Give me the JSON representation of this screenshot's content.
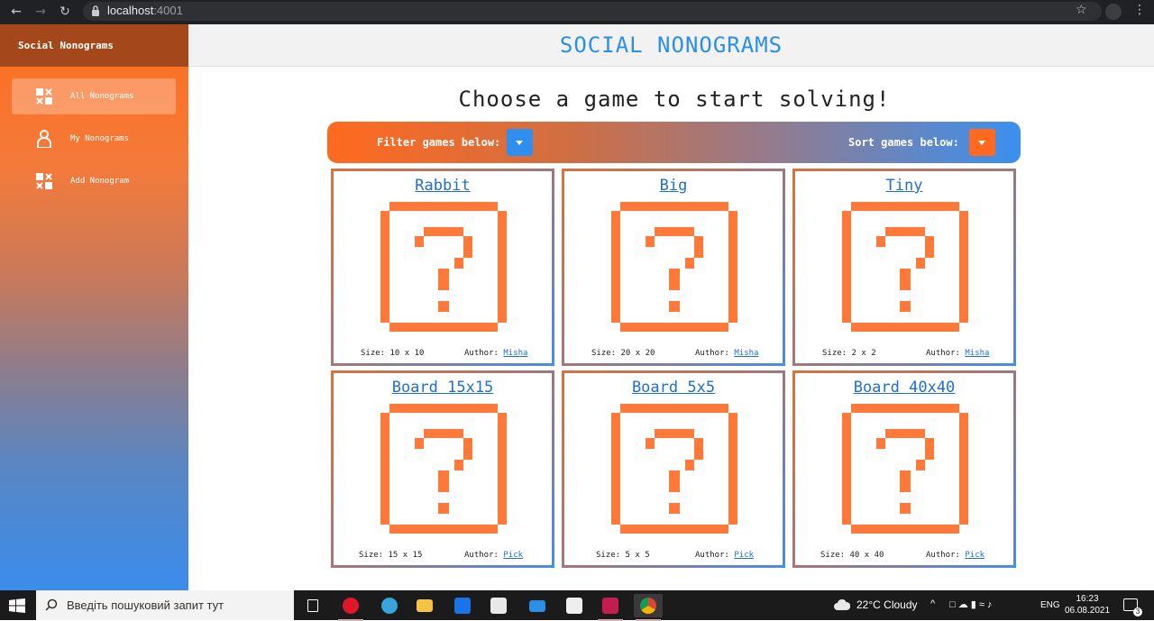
{
  "browser": {
    "url_host": "localhost",
    "url_port": ":4001",
    "back_icon": "back-arrow-icon",
    "forward_icon": "forward-arrow-icon",
    "reload_icon": "reload-icon"
  },
  "sidebar": {
    "brand": "Social Nonograms",
    "items": [
      {
        "label": "All Nonograms",
        "icon": "grid-icon",
        "active": true
      },
      {
        "label": "My Nonograms",
        "icon": "person-icon",
        "active": false
      },
      {
        "label": "Add Nonogram",
        "icon": "grid-add-icon",
        "active": false
      }
    ]
  },
  "header": {
    "title": "SOCIAL NONOGRAMS"
  },
  "main": {
    "heading": "Choose a game to start solving!",
    "filter_label": "Filter games below:",
    "sort_label": "Sort games below:"
  },
  "games": [
    {
      "name": "Rabbit",
      "size_label": "Size:",
      "size": "10 x 10",
      "author_label": "Author:",
      "author": "Misha"
    },
    {
      "name": "Big",
      "size_label": "Size:",
      "size": "20 x 20",
      "author_label": "Author:",
      "author": "Misha"
    },
    {
      "name": "Tiny",
      "size_label": "Size:",
      "size": "2 x 2",
      "author_label": "Author:",
      "author": "Misha"
    },
    {
      "name": "Board 15x15",
      "size_label": "Size:",
      "size": "15 x 15",
      "author_label": "Author:",
      "author": "Pick"
    },
    {
      "name": "Board 5x5",
      "size_label": "Size:",
      "size": "5 x 5",
      "author_label": "Author:",
      "author": "Pick"
    },
    {
      "name": "Board 40x40",
      "size_label": "Size:",
      "size": "40 x 40",
      "author_label": "Author:",
      "author": "Pick"
    }
  ],
  "taskbar": {
    "search_placeholder": "Введіть пошуковий запит тут",
    "weather": "22°C  Cloudy",
    "language": "ENG",
    "time": "16:23",
    "date": "06.08.2021",
    "notifications": "3"
  },
  "colors": {
    "accent_orange": "#ff6a1f",
    "accent_blue": "#2f8ff0",
    "question_mark": "#ff7a3a",
    "link": "#1f6fd0"
  }
}
